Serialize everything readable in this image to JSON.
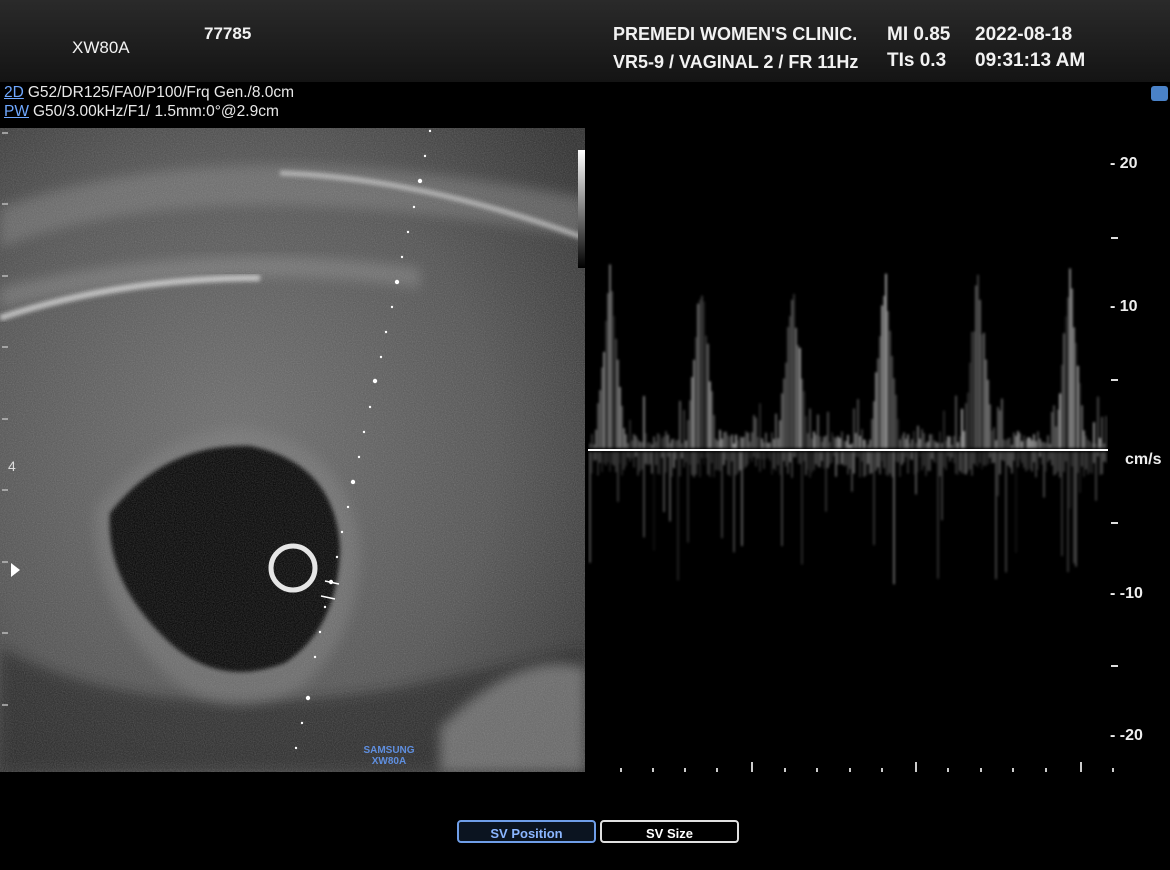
{
  "header": {
    "model": "XW80A",
    "patient_id": "77785",
    "clinic": "PREMEDI WOMEN'S CLINIC.",
    "preset": "VR5-9 / VAGINAL 2 / FR 11Hz",
    "mi": "MI  0.85",
    "tis": "TIs 0.3",
    "date": "2022-08-18",
    "time": "09:31:13 AM"
  },
  "params": {
    "twod_tag": "2D",
    "twod_text": "G52/DR125/FA0/P100/Frq Gen./8.0cm",
    "pw_tag": "PW",
    "pw_text": "G50/3.00kHz/F1/ 1.5mm:0°@2.9cm"
  },
  "bmode": {
    "depth_label": "4",
    "logo_line1": "SAMSUNG",
    "logo_line2": "XW80A"
  },
  "doppler": {
    "scale_top": "- 20",
    "scale_10": "- 10",
    "scale_neg10": "- -10",
    "scale_bottom": "- -20",
    "unit": "cm/s",
    "velocity_range_cm_s": [
      -20,
      20
    ]
  },
  "buttons": {
    "sv_position": "SV Position",
    "sv_size": "SV Size"
  },
  "colors": {
    "accent_blue": "#6f9ee8",
    "background": "#000000"
  }
}
